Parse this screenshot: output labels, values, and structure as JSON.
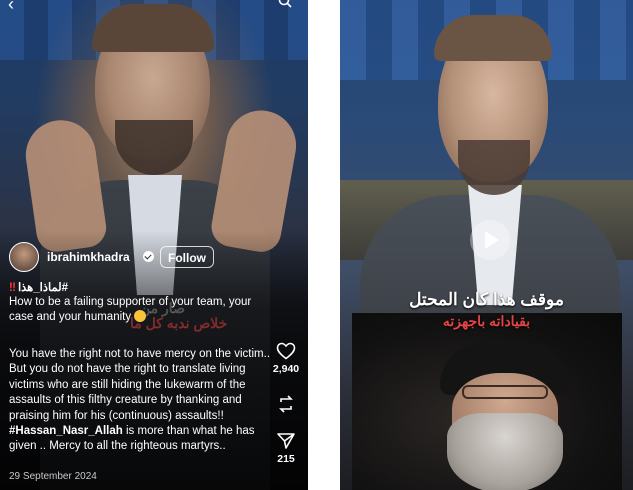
{
  "left_post": {
    "author": {
      "username": "ibrahimkhadra",
      "follow_label": "Follow"
    },
    "hashtag": "#لماذا_هذا",
    "overlay_text": [
      "صار من",
      "خلاص ندبه كل ما"
    ],
    "caption_title": "How to be a failing supporter of your team, your case and your humanity",
    "caption_body_1": "You have the right not to have mercy on the victim.. But you do not have the right to translate living victims who are still hiding the lukewarm of the assaults of this filthy creature by thanking and praising him for his (continuous) assaults!! ",
    "caption_tag": "#Hassan_Nasr_Allah",
    "caption_body_2": " is more than what he has given .. Mercy to all the righteous martyrs..",
    "date": "29 September 2024",
    "actions": {
      "likes": "2,940",
      "shares": "215"
    }
  },
  "right_post": {
    "overlay_white": "موقف هذا كان المحتل",
    "overlay_red": "بقياداته باجهزته"
  }
}
